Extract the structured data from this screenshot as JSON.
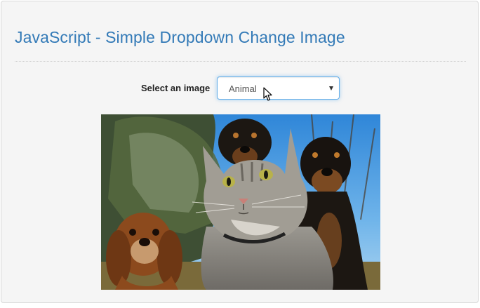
{
  "header": {
    "title": "JavaScript - Simple Dropdown Change Image"
  },
  "image_select": {
    "label": "Select an image",
    "selected": "Animal"
  },
  "icons": {
    "dropdown": "chevron-down-icon",
    "cursor": "mouse-pointer-icon"
  },
  "colors": {
    "title": "#337ab7",
    "panel_bg": "#f5f5f5",
    "select_focus_border": "#66afe9"
  }
}
